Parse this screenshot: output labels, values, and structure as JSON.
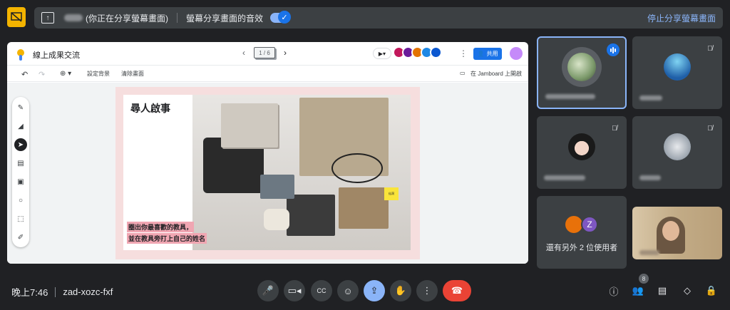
{
  "share_bar": {
    "sharing_text": "(你正在分享螢幕畫面)",
    "audio_label": "螢幕分享畫面的音效",
    "stop_label": "停止分享螢幕畫面",
    "accent": "#8ab4f8"
  },
  "jamboard": {
    "title": "線上成果交流",
    "frame_counter": "1 / 6",
    "share_label": "共用",
    "toolbar": {
      "set_background": "設定背景",
      "clear_frame": "清除畫面",
      "open_in_jamboard": "在 Jamboard 上開啟"
    },
    "frame": {
      "title": "尋人啟事",
      "note_line1": "圈出你最喜歡的教具，",
      "note_line2": "並在教具旁打上自己的姓名",
      "sticky": "仙洞"
    }
  },
  "participants": {
    "others_text": "還有另外 2 位使用者",
    "second_initial": "Z"
  },
  "bottom": {
    "time": "晚上7:46",
    "meeting_code": "zad-xozc-fxf",
    "people_count": "8",
    "end_color": "#ea4335"
  },
  "icons": [
    "present-off-icon",
    "present-icon",
    "mic-icon",
    "camera-icon",
    "captions-icon",
    "emoji-icon",
    "raise-hand-icon",
    "more-icon",
    "end-call-icon",
    "info-icon",
    "people-icon",
    "chat-icon",
    "activities-icon",
    "lock-icon"
  ]
}
